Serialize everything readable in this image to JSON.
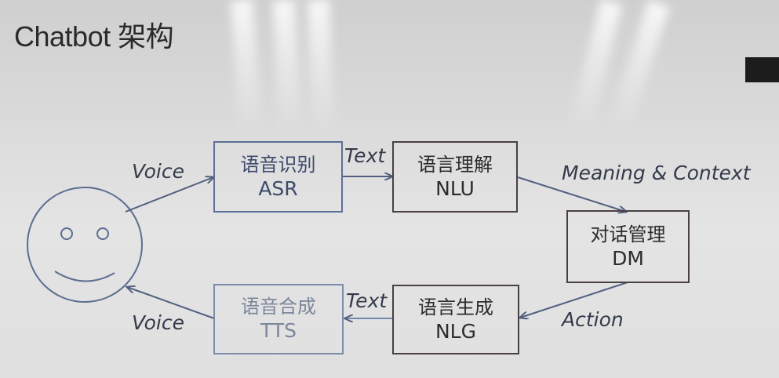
{
  "title": "Chatbot 架构",
  "boxes": {
    "asr": {
      "zh": "语音识别",
      "en": "ASR"
    },
    "nlu": {
      "zh": "语言理解",
      "en": "NLU"
    },
    "dm": {
      "zh": "对话管理",
      "en": "DM"
    },
    "nlg": {
      "zh": "语言生成",
      "en": "NLG"
    },
    "tts": {
      "zh": "语音合成",
      "en": "TTS"
    }
  },
  "edges": {
    "voice_in": "Voice",
    "text_top": "Text",
    "meaning": "Meaning & Context",
    "action": "Action",
    "text_bottom": "Text",
    "voice_out": "Voice"
  },
  "icons": {
    "user": "smiley-face-icon"
  }
}
